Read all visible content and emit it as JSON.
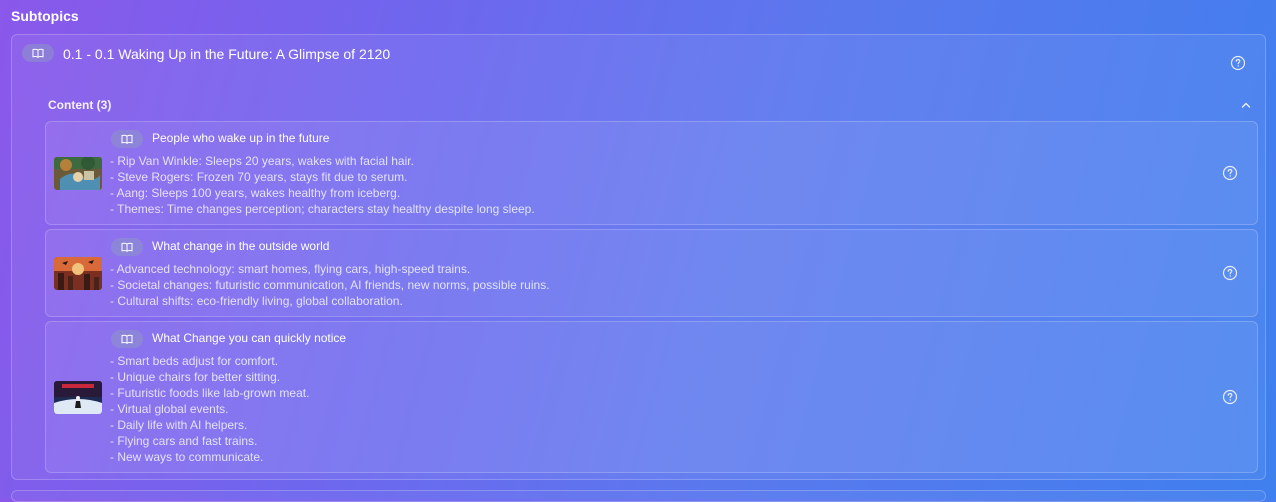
{
  "section": {
    "title": "Subtopics"
  },
  "topic": {
    "title": "0.1 - 0.1 Waking Up in the Future: A Glimpse of 2120",
    "content_header": "Content (3)",
    "cards": [
      {
        "title": "People who wake up in the future",
        "lines": [
          "- Rip Van Winkle: Sleeps 20 years, wakes with facial hair.",
          "- Steve Rogers: Frozen 70 years, stays fit due to serum.",
          "- Aang: Sleeps 100 years, wakes healthy from iceberg.",
          "- Themes: Time changes perception; characters stay healthy despite long sleep."
        ]
      },
      {
        "title": "What change in the outside world",
        "lines": [
          "- Advanced technology: smart homes, flying cars, high-speed trains.",
          "- Societal changes: futuristic communication, AI friends, new norms, possible ruins.",
          "- Cultural shifts: eco-friendly living, global collaboration."
        ]
      },
      {
        "title": "What Change you can quickly notice",
        "lines": [
          "- Smart beds adjust for comfort.",
          "- Unique chairs for better sitting.",
          "- Futuristic foods like lab-grown meat.",
          "- Virtual global events.",
          "- Daily life with AI helpers.",
          "- Flying cars and fast trains.",
          "- New ways to communicate."
        ]
      }
    ]
  },
  "icons": {
    "book": "book-open-icon",
    "help": "question-circle-icon",
    "collapse": "chevron-up-icon"
  }
}
